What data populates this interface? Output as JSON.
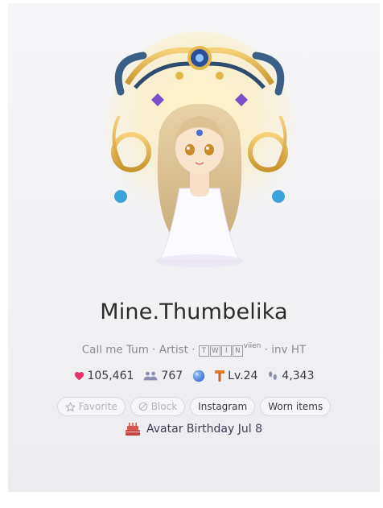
{
  "profile": {
    "display_name": "Mine.Thumbelika",
    "bio": {
      "part1": "Call me Tum · Artist · ",
      "boxed_letters": [
        "T",
        "W",
        "I",
        "N"
      ],
      "boxed_suffix": "viien",
      "part2": " · inv HT"
    }
  },
  "stats": {
    "likes": "105,461",
    "friends": "767",
    "level": "Lv.24",
    "footprints": "4,343"
  },
  "actions": {
    "favorite_label": "Favorite",
    "block_label": "Block",
    "instagram_label": "Instagram",
    "worn_items_label": "Worn items"
  },
  "birthday": {
    "label": "Avatar Birthday Jul 8"
  },
  "colors": {
    "heart": "#e8336b",
    "friends": "#8a8fb0",
    "globe": "#4a7fd6",
    "level": "#e07b2e",
    "cake": "#d9534f"
  }
}
